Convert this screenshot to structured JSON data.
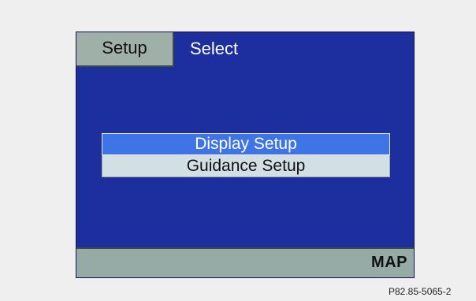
{
  "header": {
    "tab_label": "Setup",
    "title": "Select"
  },
  "menu": {
    "items": [
      {
        "label": "Display Setup",
        "state": "selected"
      },
      {
        "label": "Guidance Setup",
        "state": "normal"
      }
    ]
  },
  "footer": {
    "map_label": "MAP"
  },
  "reference": "P82.85-5065-2",
  "colors": {
    "screen_bg": "#1d2f9f",
    "tab_bg": "#9fb0a8",
    "selected_bg": "#3f74e6",
    "item_bg": "#d3e0e3",
    "footer_bg": "#96aba5"
  }
}
